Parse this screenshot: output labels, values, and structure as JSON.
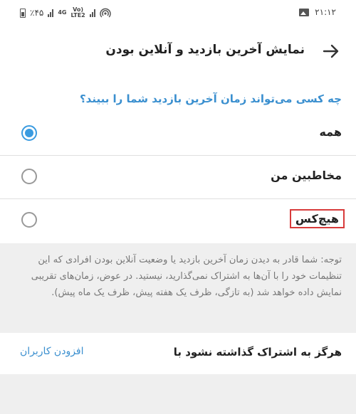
{
  "status_bar": {
    "battery": "٪۴۵",
    "network": [
      "4G",
      "Vo)",
      "LTE2"
    ],
    "time": "۲۱:۱۲"
  },
  "header": {
    "back_icon": "arrow-right-icon",
    "title": "نمایش آخرین بازدید و آنلاین بودن"
  },
  "privacy": {
    "question": "چه کسی می‌تواند زمان آخرین بازدید شما را ببیند؟",
    "options": [
      {
        "label": "همه",
        "checked": true
      },
      {
        "label": "مخاطبین من",
        "checked": false
      },
      {
        "label": "هیچ‌کس",
        "checked": false
      }
    ]
  },
  "note": "توجه: شما قادر به دیدن زمان آخرین بازدید یا وضعیت آنلاین بودن افرادی که این تنظیمات خود را با آن‌ها به اشتراک نمی‌گذارید، نیستید. در عوض، زمان‌های تقریبی نمایش داده خواهد شد (به تازگی، ظرف یک هفته پیش، ظرف یک ماه پیش).",
  "exceptions": {
    "never_share_label": "هرگز به اشتراک گذاشته نشود با",
    "add_users_label": "افزودن کاربران"
  },
  "colors": {
    "accent": "#3a8fcf",
    "radio_checked": "#3a9be0",
    "highlight_box": "#d83b3b",
    "background": "#efefef"
  }
}
